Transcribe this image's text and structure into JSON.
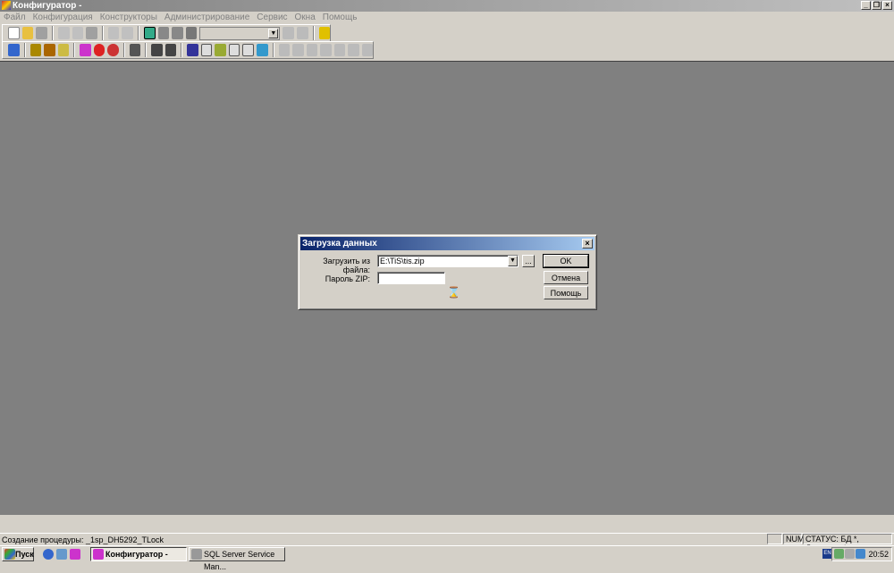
{
  "window": {
    "title": "Конфигуратор -"
  },
  "menu": [
    "Файл",
    "Конфигурация",
    "Конструкторы",
    "Администрирование",
    "Сервис",
    "Окна",
    "Помощь"
  ],
  "dialog": {
    "title": "Загрузка данных",
    "file_label": "Загрузить из файла:",
    "file_value": "E:\\TiS\\tis.zip",
    "browse_label": "...",
    "password_label": "Пароль ZIP:",
    "password_value": "",
    "ok": "OK",
    "cancel": "Отмена",
    "help": "Помощь"
  },
  "status": {
    "message": "Создание процедуры: _1sp_DH5292_TLock",
    "num": "NUM",
    "state": "СТАТУС: БД *, Документ *"
  },
  "taskbar": {
    "start": "Пуск",
    "tasks": [
      "Конфигуратор -",
      "SQL Server Service Man..."
    ],
    "tray_lang": "EN",
    "clock": "20:52"
  }
}
